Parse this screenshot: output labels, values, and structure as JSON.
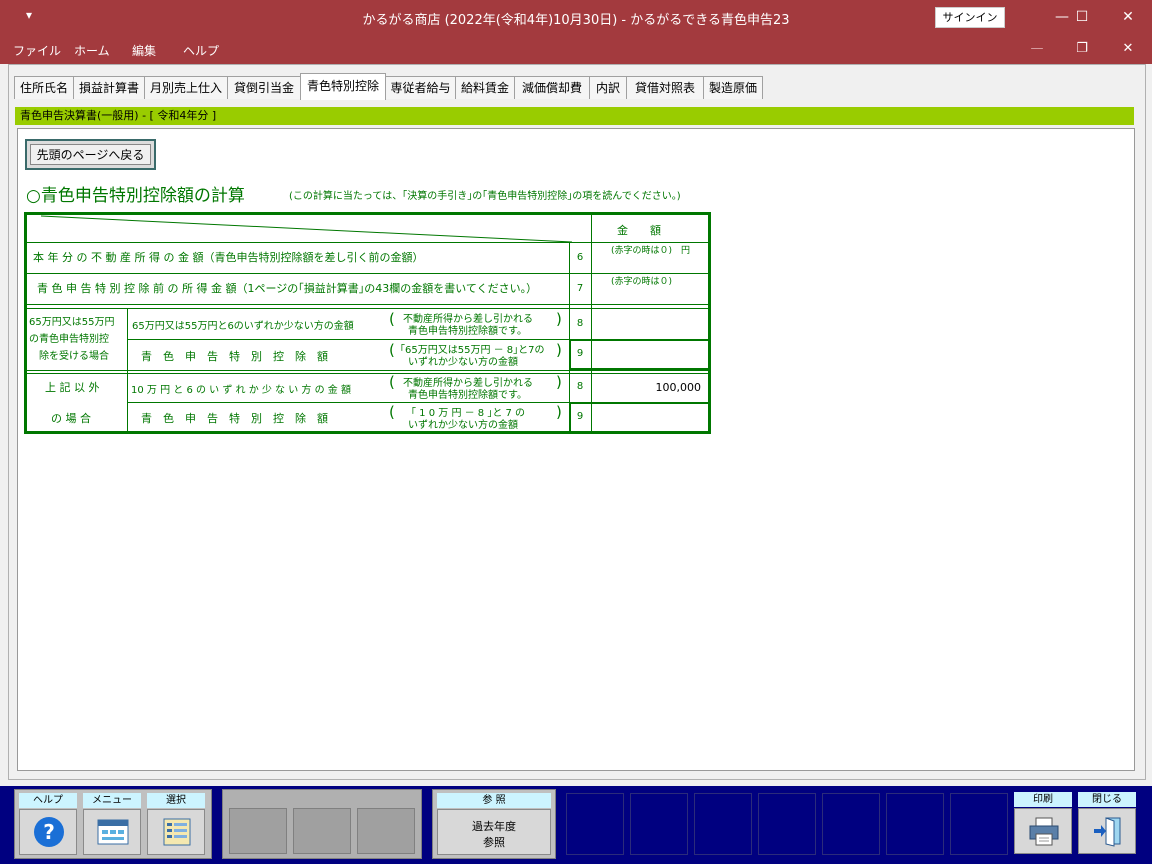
{
  "window": {
    "title": "かるがる商店 (2022年(令和4年)10月30日)  -  かるがるできる青色申告23",
    "quick_access": "▾",
    "signin": "サインイン",
    "minimize": "—",
    "maximize": "☐",
    "close": "✕",
    "restore": "❐"
  },
  "menu": {
    "items": [
      "ファイル",
      "ホーム",
      "編集",
      "ヘルプ"
    ]
  },
  "tabs": [
    "住所氏名",
    "損益計算書",
    "月別売上仕入",
    "貸倒引当金",
    "青色特別控除",
    "専従者給与",
    "給料賃金",
    "減価償却費",
    "内訳",
    "貸借対照表",
    "製造原価"
  ],
  "active_tab": "青色特別控除",
  "header_bar": "青色申告決算書(一般用) - [ 令和4年分 ]",
  "back_button": "先頭のページへ戻る",
  "form": {
    "heading": "○青色申告特別控除額の計算",
    "heading_note": "(この計算に当たっては、｢決算の手引き｣の｢青色申告特別控除｣の項を読んでください。)",
    "col_amount": "金　　額",
    "row6_label": "本 年 分 の 不 動 産 所 得 の 金 額（青色申告特別控除額を差し引く前の金額）",
    "row6_num": "6",
    "row6_note": "(赤字の時は０)　円",
    "row7_label": "青 色 申 告 特 別 控 除 前 の 所 得 金 額（1ページの｢損益計算書｣の43欄の金額を書いてください。）",
    "row7_num": "7",
    "row7_note": "(赤字の時は０)",
    "group1_label_1": "65万円又は55万円",
    "group1_label_2": "の青色申告特別控",
    "group1_label_3": "除を受ける場合",
    "g1_r8_label": "65万円又は55万円と6のいずれか少ない方の金額",
    "g1_r8_note_1": "不動産所得から差し引かれる",
    "g1_r8_note_2": "青色申告特別控除額です。",
    "g1_r8_num": "8",
    "g1_r8_value": "",
    "g1_r9_label": "青　色　申　告　特　別　控　除　額",
    "g1_r9_note_1": "｢65万円又は55万円 － 8｣と7の",
    "g1_r9_note_2": "いずれか少ない方の金額",
    "g1_r9_num": "9",
    "g1_r9_value": "",
    "group2_label_1": "上 記 以 外",
    "group2_label_2": "の 場 合",
    "g2_r8_label": "10 万 円 と 6 の い ず れ か 少 な い 方 の 金 額",
    "g2_r8_note_1": "不動産所得から差し引かれる",
    "g2_r8_note_2": "青色申告特別控除額です。",
    "g2_r8_num": "8",
    "g2_r8_value": "100,000",
    "g2_r9_label": "青　色　申　告　特　別　控　除　額",
    "g2_r9_note_1": "｢ 1 0 万 円 － 8 ｣と 7 の",
    "g2_r9_note_2": "いずれか少ない方の金額",
    "g2_r9_num": "9",
    "g2_r9_value": "",
    "paren_open": "(",
    "paren_close": ")"
  },
  "toolbar": {
    "help_label": "ヘルプ",
    "menu_label": "メニュー",
    "select_label": "選択",
    "ref_label": "参 照",
    "past_year_button": "過去年度\n参照",
    "print_label": "印刷",
    "close_label": "閉じる",
    "help_icon_glyph": "?"
  },
  "colors": {
    "title_bar": "#a33a3e",
    "accent_green": "#007700",
    "green_bar": "#99cc00",
    "bottom_bar": "#000080"
  }
}
